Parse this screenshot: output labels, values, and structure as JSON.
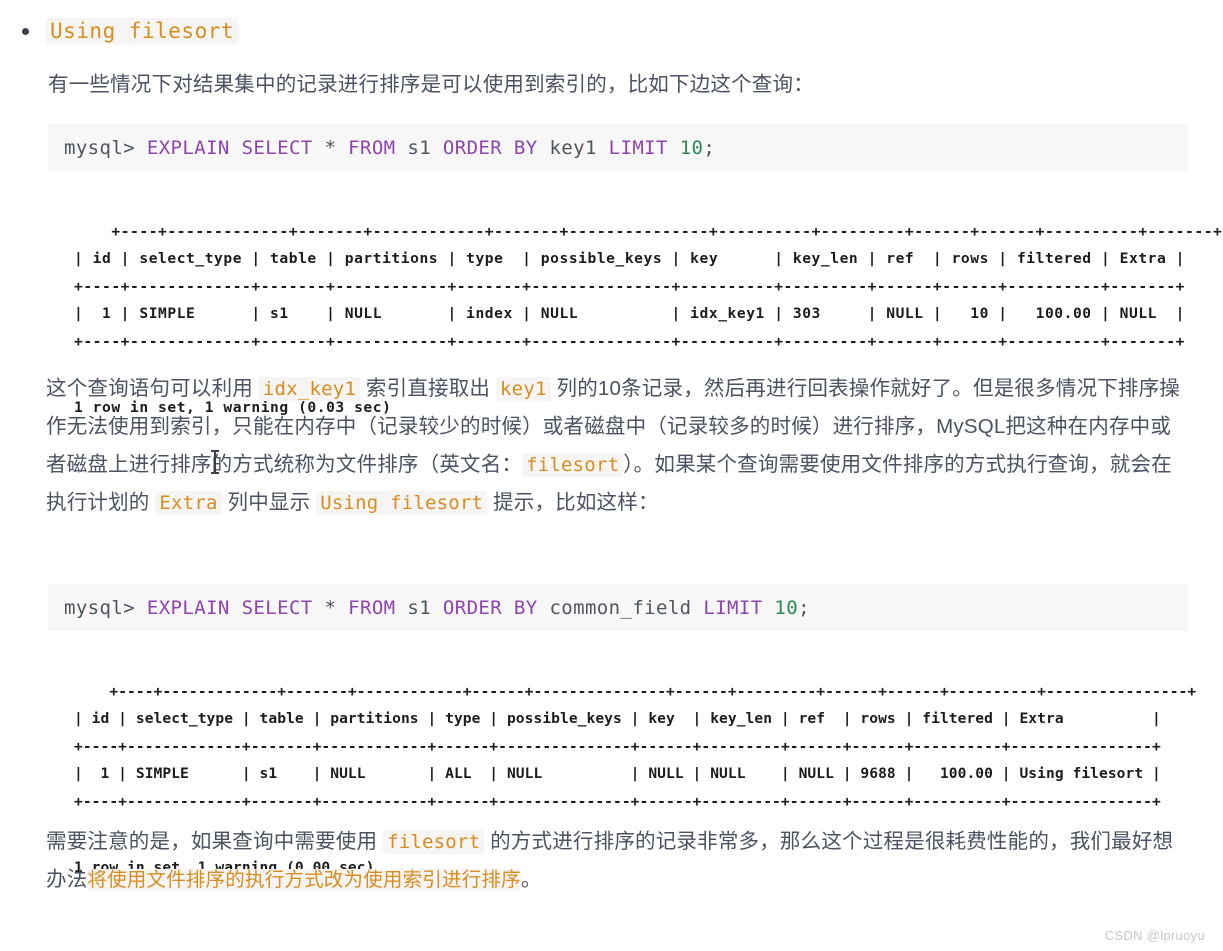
{
  "heading": {
    "bullet_code": "Using filesort"
  },
  "paragraphs": {
    "intro": "有一些情况下对结果集中的记录进行排序是可以使用到索引的，比如下边这个查询：",
    "mid_parts": {
      "p1": "这个查询语句可以利用 ",
      "c1": "idx_key1",
      "p2": " 索引直接取出 ",
      "c2": "key1",
      "p3": " 列的10条记录，然后再进行回表操作就好了。但是很多情况下排序操作无法使用到索引，只能在内存中（记录较少的时候）或者磁盘中（记录较多的时候）进行排序，MySQL把这种在内存中或者磁盘上进行排序的方式统称为文件排序（英文名：",
      "c3": "filesort",
      "p4": "）。如果某个查询需要使用文件排序的方式执行查询，就会在执行计划的 ",
      "c4": "Extra",
      "p5": " 列中显示 ",
      "c5": "Using filesort",
      "p6": " 提示，比如这样："
    },
    "end_parts": {
      "p1": "需要注意的是，如果查询中需要使用 ",
      "c1": "filesort",
      "p2": " 的方式进行排序的记录非常多，那么这个过程是很耗费性能的，我们最好想办法",
      "h1": "将使用文件排序的执行方式改为使用索引进行排序",
      "p3": "。"
    }
  },
  "code_blocks": [
    {
      "prompt": "mysql> ",
      "tokens": [
        {
          "text": "EXPLAIN SELECT ",
          "type": "kw"
        },
        {
          "text": "* ",
          "type": "pln"
        },
        {
          "text": "FROM ",
          "type": "kw"
        },
        {
          "text": "s1 ",
          "type": "pln"
        },
        {
          "text": "ORDER BY ",
          "type": "kw"
        },
        {
          "text": "key1 ",
          "type": "pln"
        },
        {
          "text": "LIMIT ",
          "type": "kw"
        },
        {
          "text": "10",
          "type": "num"
        },
        {
          "text": ";",
          "type": "pln"
        }
      ],
      "full_text": "mysql> EXPLAIN SELECT * FROM s1 ORDER BY key1 LIMIT 10;"
    },
    {
      "prompt": "mysql> ",
      "tokens": [
        {
          "text": "EXPLAIN SELECT ",
          "type": "kw"
        },
        {
          "text": "* ",
          "type": "pln"
        },
        {
          "text": "FROM ",
          "type": "kw"
        },
        {
          "text": "s1 ",
          "type": "pln"
        },
        {
          "text": "ORDER BY ",
          "type": "kw"
        },
        {
          "text": "common_field ",
          "type": "pln"
        },
        {
          "text": "LIMIT ",
          "type": "kw"
        },
        {
          "text": "10",
          "type": "num"
        },
        {
          "text": ";",
          "type": "pln"
        }
      ],
      "full_text": "mysql> EXPLAIN SELECT * FROM s1 ORDER BY common_field LIMIT 10;"
    }
  ],
  "results": [
    {
      "columns": [
        "id",
        "select_type",
        "table",
        "partitions",
        "type",
        "possible_keys",
        "key",
        "key_len",
        "ref",
        "rows",
        "filtered",
        "Extra"
      ],
      "rows": [
        [
          "1",
          "SIMPLE",
          "s1",
          "NULL",
          "index",
          "NULL",
          "idx_key1",
          "303",
          "NULL",
          "10",
          "100.00",
          "NULL"
        ]
      ],
      "ascii": "+----+-------------+-------+------------+-------+---------------+----------+---------+------+------+----------+-------+\n| id | select_type | table | partitions | type  | possible_keys | key      | key_len | ref  | rows | filtered | Extra |\n+----+-------------+-------+------------+-------+---------------+----------+---------+------+------+----------+-------+\n|  1 | SIMPLE      | s1    | NULL       | index | NULL          | idx_key1 | 303     | NULL |   10 |   100.00 | NULL  |\n+----+-------------+-------+------------+-------+---------------+----------+---------+------+------+----------+-------+",
      "status": "1 row in set, 1 warning (0.03 sec)"
    },
    {
      "columns": [
        "id",
        "select_type",
        "table",
        "partitions",
        "type",
        "possible_keys",
        "key",
        "key_len",
        "ref",
        "rows",
        "filtered",
        "Extra"
      ],
      "rows": [
        [
          "1",
          "SIMPLE",
          "s1",
          "NULL",
          "ALL",
          "NULL",
          "NULL",
          "NULL",
          "NULL",
          "9688",
          "100.00",
          "Using filesort"
        ]
      ],
      "ascii": "+----+-------------+-------+------------+------+---------------+------+---------+------+------+----------+----------------+\n| id | select_type | table | partitions | type | possible_keys | key  | key_len | ref  | rows | filtered | Extra          |\n+----+-------------+-------+------------+------+---------------+------+---------+------+------+----------+----------------+\n|  1 | SIMPLE      | s1    | NULL       | ALL  | NULL          | NULL | NULL    | NULL | 9688 |   100.00 | Using filesort |\n+----+-------------+-------+------------+------+---------------+------+---------+------+------+----------+----------------+",
      "status": "1 row in set, 1 warning (0.00 sec)"
    }
  ],
  "watermark": "CSDN @lpruoyu",
  "colors": {
    "code_orange": "#d98c1f",
    "code_bg": "#f6f5f3",
    "keyword_purple": "#8e44ad",
    "number_green": "#2e8b57",
    "body_text": "#4a5263",
    "block_bg": "#f7f7f8"
  }
}
